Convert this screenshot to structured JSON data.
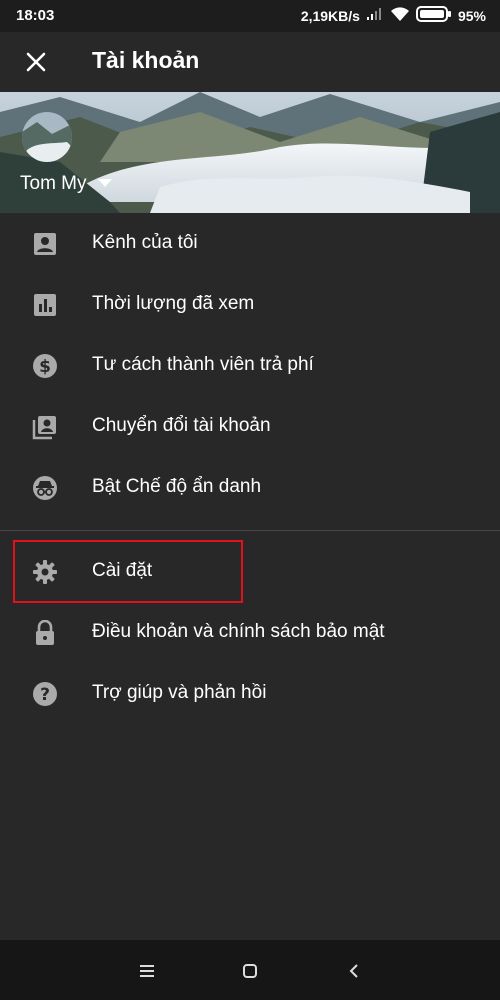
{
  "status_bar": {
    "time": "18:03",
    "network_speed": "2,19KB/s",
    "battery": "95%",
    "icons": [
      "signal-icon",
      "wifi-icon",
      "battery-icon"
    ]
  },
  "app_bar": {
    "title": "Tài khoản",
    "close_icon": "close-icon"
  },
  "account": {
    "name": "Tom My",
    "dropdown_icon": "caret-down-icon"
  },
  "menu": {
    "items": [
      {
        "label": "Kênh của tôi",
        "icon": "account-box-icon"
      },
      {
        "label": "Thời lượng đã xem",
        "icon": "bar-chart-icon"
      },
      {
        "label": "Tư cách thành viên trả phí",
        "icon": "dollar-circle-icon"
      },
      {
        "label": "Chuyển đổi tài khoản",
        "icon": "switch-account-icon"
      },
      {
        "label": "Bật Chế độ ẩn danh",
        "icon": "incognito-icon"
      }
    ],
    "secondary_items": [
      {
        "label": "Cài đặt",
        "icon": "gear-icon",
        "highlighted": true
      },
      {
        "label": "Điều khoản và chính sách bảo mật",
        "icon": "lock-icon"
      },
      {
        "label": "Trợ giúp và phản hồi",
        "icon": "help-icon"
      }
    ]
  },
  "colors": {
    "background": "#282828",
    "highlight_border": "#e0131b",
    "icon_gray": "#aaaaaa",
    "nav_bar": "#161616"
  },
  "nav_bar": {
    "buttons": [
      "menu-icon",
      "home-square-icon",
      "back-icon"
    ]
  }
}
